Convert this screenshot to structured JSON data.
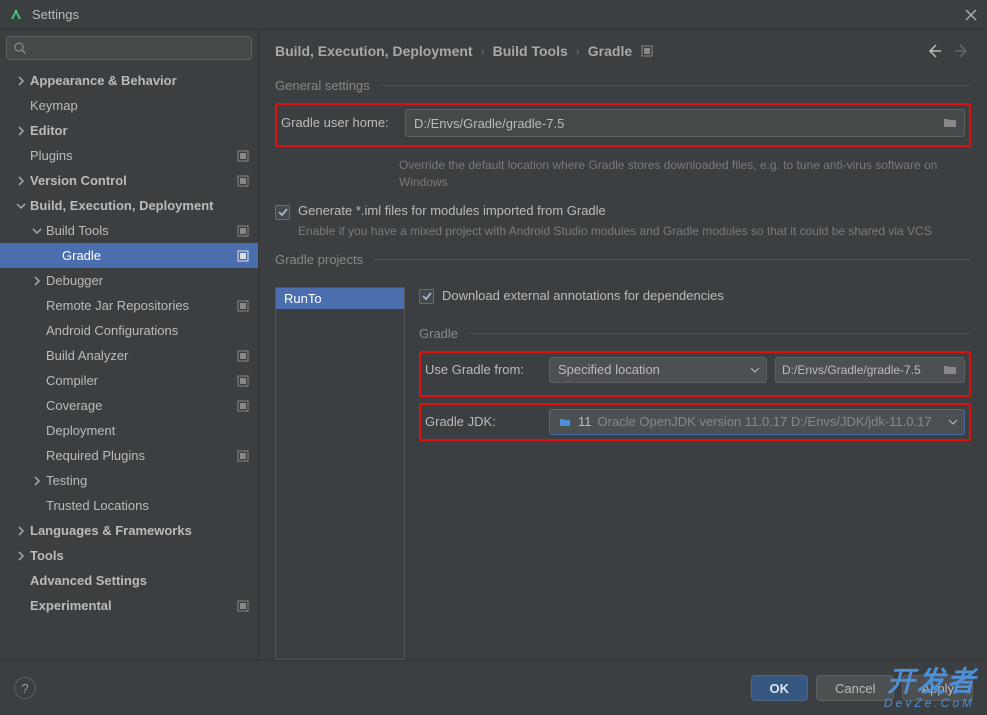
{
  "titlebar": {
    "title": "Settings"
  },
  "search": {
    "placeholder": ""
  },
  "tree": {
    "appearance": "Appearance & Behavior",
    "keymap": "Keymap",
    "editor": "Editor",
    "plugins": "Plugins",
    "version_control": "Version Control",
    "bed": "Build, Execution, Deployment",
    "build_tools": "Build Tools",
    "gradle": "Gradle",
    "debugger": "Debugger",
    "remote_jar": "Remote Jar Repositories",
    "android_config": "Android Configurations",
    "build_analyzer": "Build Analyzer",
    "compiler": "Compiler",
    "coverage": "Coverage",
    "deployment": "Deployment",
    "required_plugins": "Required Plugins",
    "testing": "Testing",
    "trusted": "Trusted Locations",
    "languages": "Languages & Frameworks",
    "tools": "Tools",
    "advanced": "Advanced Settings",
    "experimental": "Experimental"
  },
  "breadcrumb": {
    "p1": "Build, Execution, Deployment",
    "p2": "Build Tools",
    "p3": "Gradle"
  },
  "sections": {
    "general": "General settings",
    "projects": "Gradle projects",
    "inner_gradle": "Gradle"
  },
  "form": {
    "user_home_label": "Gradle user home:",
    "user_home_value": "D:/Envs/Gradle/gradle-7.5",
    "user_home_hint": "Override the default location where Gradle stores downloaded files, e.g. to tune anti-virus software on Windows",
    "iml_label": "Generate *.iml files for modules imported from Gradle",
    "iml_hint": "Enable if you have a mixed project with Android Studio modules and Gradle modules so that it could be shared via VCS",
    "download_annotations": "Download external annotations for dependencies",
    "use_gradle_from_label": "Use Gradle from:",
    "use_gradle_from_value": "Specified location",
    "gradle_location": "D:/Envs/Gradle/gradle-7.5",
    "jdk_label": "Gradle JDK:",
    "jdk_version": "11",
    "jdk_detail": "Oracle OpenJDK version 11.0.17 D:/Envs/JDK/jdk-11.0.17"
  },
  "projects_list": {
    "item0": "RunTo"
  },
  "footer": {
    "ok": "OK",
    "cancel": "Cancel",
    "apply": "Apply",
    "help": "?"
  },
  "watermark": {
    "main": "开发者",
    "sub": "DevZe.CoM"
  }
}
